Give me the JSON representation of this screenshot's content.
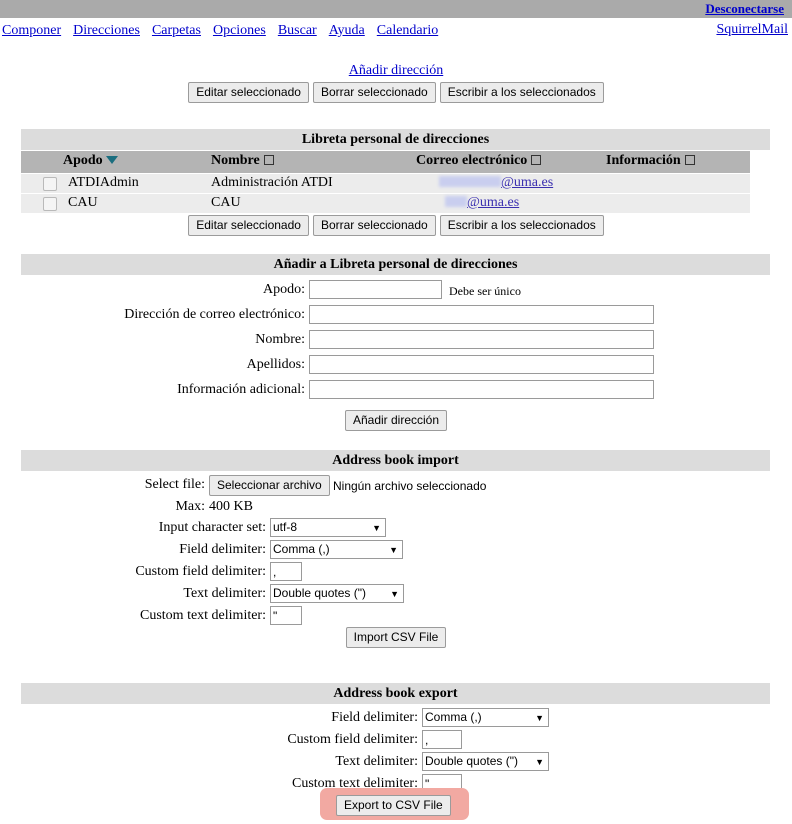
{
  "topbar": {
    "logout_label": "Desconectarse"
  },
  "nav": {
    "items": [
      {
        "label": "Componer"
      },
      {
        "label": "Direcciones"
      },
      {
        "label": "Carpetas"
      },
      {
        "label": "Opciones"
      },
      {
        "label": "Buscar"
      },
      {
        "label": "Ayuda"
      },
      {
        "label": "Calendario"
      }
    ],
    "brand": "SquirrelMail"
  },
  "top_actions": {
    "add_address_link": "Añadir dirección",
    "edit_selected": "Editar seleccionado",
    "delete_selected": "Borrar seleccionado",
    "write_selected": "Escribir a los seleccionados"
  },
  "address_book": {
    "title": "Libreta personal de direcciones",
    "columns": [
      {
        "label": "Apodo",
        "sort": "desc"
      },
      {
        "label": "Nombre",
        "sort": "none"
      },
      {
        "label": "Correo electrónico",
        "sort": "none"
      },
      {
        "label": "Información",
        "sort": "none"
      }
    ],
    "rows": [
      {
        "nickname": "ATDIAdmin",
        "name": "Administración ATDI",
        "email_redacted_width": 62,
        "email_domain": "@uma.es",
        "info": ""
      },
      {
        "nickname": "CAU",
        "name": "CAU",
        "email_redacted_width": 22,
        "email_domain": "@uma.es",
        "info": ""
      }
    ],
    "bottom_actions": {
      "edit_selected": "Editar seleccionado",
      "delete_selected": "Borrar seleccionado",
      "write_selected": "Escribir a los seleccionados"
    }
  },
  "add_form": {
    "title": "Añadir a Libreta personal de direcciones",
    "fields": [
      {
        "label": "Apodo:",
        "value": "",
        "hint": "Debe ser único"
      },
      {
        "label": "Dirección de correo electrónico:",
        "value": "",
        "hint": ""
      },
      {
        "label": "Nombre:",
        "value": "",
        "hint": ""
      },
      {
        "label": "Apellidos:",
        "value": "",
        "hint": ""
      },
      {
        "label": "Información adicional:",
        "value": "",
        "hint": ""
      }
    ],
    "submit_label": "Añadir dirección"
  },
  "import": {
    "title": "Address book import",
    "select_file_label": "Select file:",
    "file_button_label": "Seleccionar archivo",
    "file_status": "Ningún archivo seleccionado",
    "max_label": "Max:",
    "max_value": "400 KB",
    "charset_label": "Input character set:",
    "charset_value": "utf-8",
    "field_delimiter_label": "Field delimiter:",
    "field_delimiter_value": "Comma (,)",
    "custom_field_label": "Custom field delimiter:",
    "custom_field_value": ",",
    "text_delimiter_label": "Text delimiter:",
    "text_delimiter_value": "Double quotes (\")",
    "custom_text_label": "Custom text delimiter:",
    "custom_text_value": "\"",
    "submit_label": "Import CSV File"
  },
  "export": {
    "title": "Address book export",
    "field_delimiter_label": "Field delimiter:",
    "field_delimiter_value": "Comma (,)",
    "custom_field_label": "Custom field delimiter:",
    "custom_field_value": ",",
    "text_delimiter_label": "Text delimiter:",
    "text_delimiter_value": "Double quotes (\")",
    "custom_text_label": "Custom text delimiter:",
    "custom_text_value": "\"",
    "submit_label": "Export to CSV File",
    "highlight_color": "#f2a9a2"
  }
}
